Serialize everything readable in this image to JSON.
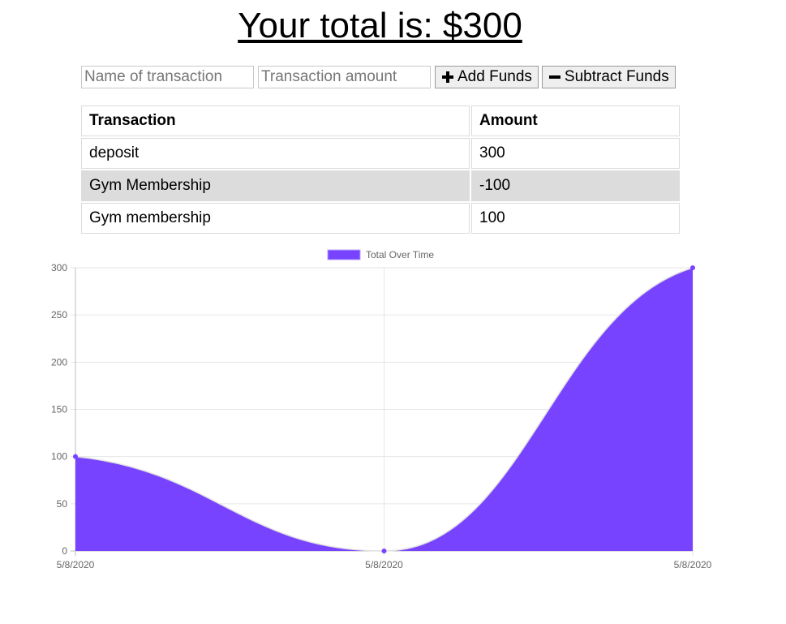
{
  "header": {
    "title": "Your total is: $300"
  },
  "form": {
    "name_placeholder": "Name of transaction",
    "amount_placeholder": "Transaction amount",
    "add_label": "Add Funds",
    "subtract_label": "Subtract Funds",
    "add_icon": "plus-icon",
    "subtract_icon": "minus-icon"
  },
  "table": {
    "headers": [
      "Transaction",
      "Amount"
    ],
    "rows": [
      {
        "name": "deposit",
        "amount": "300"
      },
      {
        "name": "Gym Membership",
        "amount": "-100"
      },
      {
        "name": "Gym membership",
        "amount": "100"
      }
    ],
    "highlight_color": "#dcdcdc"
  },
  "chart_data": {
    "type": "area",
    "legend_position": "top",
    "grid": true,
    "x": [
      "5/8/2020",
      "5/8/2020",
      "5/8/2020"
    ],
    "series": [
      {
        "name": "Total Over Time",
        "values": [
          100,
          0,
          300
        ],
        "color": "#7843ff"
      }
    ],
    "ylim": [
      0,
      300
    ],
    "yticks": [
      0,
      50,
      100,
      150,
      200,
      250,
      300
    ],
    "title": "",
    "xlabel": "",
    "ylabel": ""
  }
}
